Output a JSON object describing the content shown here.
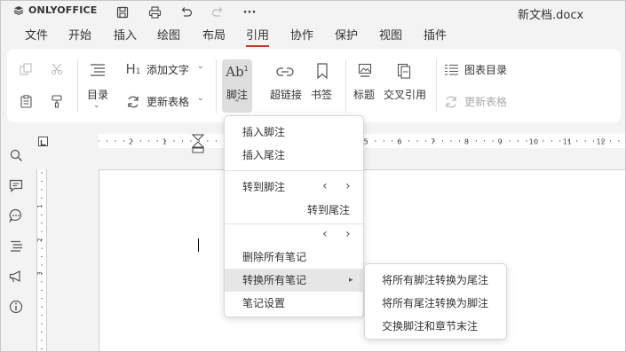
{
  "app": {
    "name": "ONLYOFFICE",
    "doc_title": "新文档.docx"
  },
  "quick_access": {
    "icons": [
      "save-icon",
      "print-icon",
      "undo-icon",
      "redo-icon",
      "more-icon"
    ],
    "more": "···"
  },
  "menu_tabs": [
    "文件",
    "开始",
    "插入",
    "绘图",
    "布局",
    "引用",
    "协作",
    "保护",
    "视图",
    "插件"
  ],
  "active_tab": "引用",
  "ribbon": {
    "toc": "目录",
    "add_text": "添加文字",
    "update_table": "更新表格",
    "footnote": "脚注",
    "footnote_glyph": "Ab",
    "footnote_sup": "1",
    "hyperlink": "超链接",
    "bookmark": "书签",
    "caption": "标题",
    "cross_ref": "交叉引用",
    "table_of_figures": "图表目录",
    "update_table2": "更新表格"
  },
  "ruler": {
    "h_ticks": [
      "2",
      "1",
      "1",
      "2",
      "3",
      "4",
      "5",
      "6",
      "7",
      "8",
      "9",
      "10",
      "11",
      "12"
    ],
    "v_ticks": [
      "1",
      "2",
      "3"
    ]
  },
  "footnote_menu": {
    "insert_footnote": "插入脚注",
    "insert_endnote": "插入尾注",
    "goto_footnote": "转到脚注",
    "goto_endnote": "转到尾注",
    "delete_all": "删除所有笔记",
    "convert_all": "转换所有笔记",
    "note_settings": "笔记设置",
    "submenu_arrow": "▸"
  },
  "convert_submenu": [
    "将所有脚注转换为尾注",
    "将所有尾注转换为脚注",
    "交换脚注和章节末注"
  ]
}
